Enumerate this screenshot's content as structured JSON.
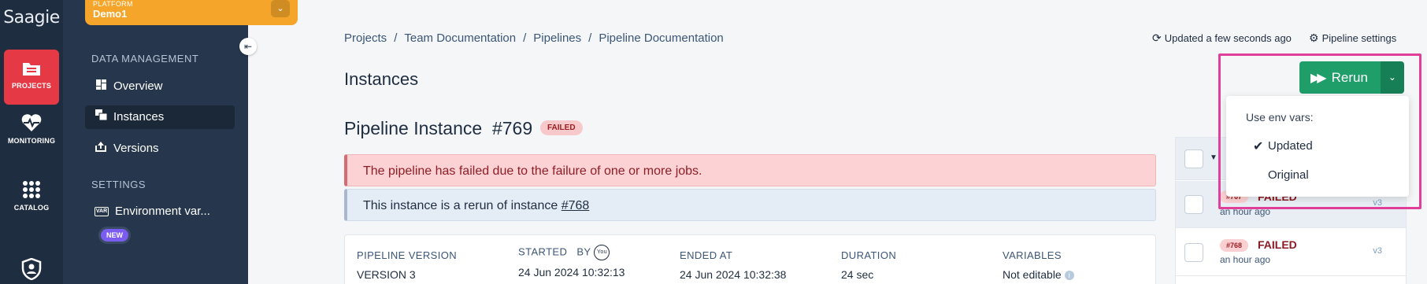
{
  "rail": {
    "logo": "Saagie",
    "items": [
      {
        "label": "PROJECTS",
        "icon": "folder-icon",
        "active": true
      },
      {
        "label": "MONITORING",
        "icon": "heartbeat-icon"
      },
      {
        "label": "CATALOG",
        "icon": "grid-icon"
      },
      {
        "label": "",
        "icon": "shield-user-icon"
      }
    ]
  },
  "platform": {
    "label": "PLATFORM",
    "name": "Demo1"
  },
  "sidebar": {
    "data_section": "DATA MANAGEMENT",
    "items": [
      {
        "label": "Overview",
        "icon": "dashboard-icon"
      },
      {
        "label": "Instances",
        "icon": "copies-icon",
        "active": true
      },
      {
        "label": "Versions",
        "icon": "upload-box-icon"
      }
    ],
    "settings_section": "SETTINGS",
    "env_item": {
      "icon_text": "VAR",
      "label": "Environment var...",
      "badge": "NEW"
    }
  },
  "breadcrumb": [
    "Projects",
    "Team Documentation",
    "Pipelines",
    "Pipeline Documentation"
  ],
  "breadcrumb_sep": "/",
  "header": {
    "updated": "Updated a few seconds ago",
    "settings": "Pipeline settings"
  },
  "page_title": "Instances",
  "rerun": {
    "label": "Rerun"
  },
  "instance": {
    "title": "Pipeline Instance",
    "number": "#769",
    "status": "FAILED",
    "error_message": "The pipeline has failed due to the failure of one or more jobs.",
    "rerun_message": "This instance is a rerun of instance",
    "rerun_link": "#768"
  },
  "details": {
    "version_label": "PIPELINE VERSION",
    "version_value": "VERSION 3",
    "started_label": "STARTED",
    "by_label": "BY",
    "by_badge": "You",
    "started_value": "24 Jun 2024 10:32:13",
    "ended_label": "ENDED AT",
    "ended_value": "24 Jun 2024 10:32:38",
    "duration_label": "DURATION",
    "duration_value": "24 sec",
    "variables_label": "VARIABLES",
    "variables_value": "Not editable"
  },
  "list": {
    "rows": [
      {
        "num": "#767",
        "status": "FAILED",
        "time": "an hour ago",
        "version": "v3"
      },
      {
        "num": "#768",
        "status": "FAILED",
        "time": "an hour ago",
        "version": "v3"
      }
    ]
  },
  "menu": {
    "label": "Use env vars:",
    "options": [
      {
        "label": "Updated",
        "selected": true
      },
      {
        "label": "Original",
        "selected": false
      }
    ]
  },
  "colors": {
    "accent_green": "#1f9e6a",
    "danger": "#e63946",
    "highlight": "#e0409a",
    "platform": "#f4a52a"
  }
}
